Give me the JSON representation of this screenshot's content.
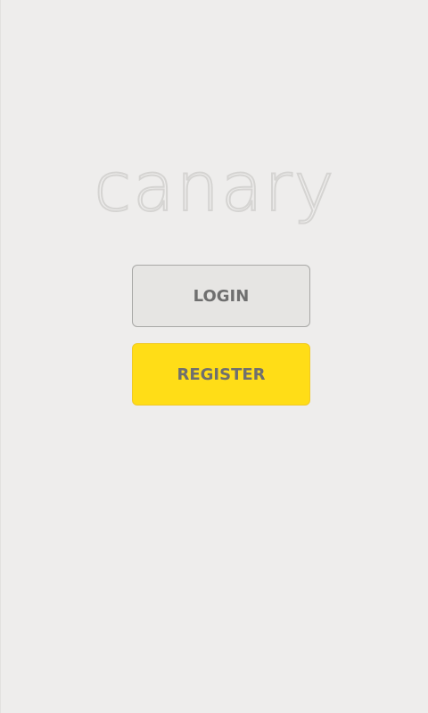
{
  "app": {
    "logo_text": "canary"
  },
  "actions": {
    "login_label": "LOGIN",
    "register_label": "REGISTER"
  },
  "colors": {
    "background": "#eeedec",
    "login_button": "#e6e5e3",
    "register_button": "#ffdd17",
    "button_text": "#6f6f6f",
    "logo_outline": "#d5d4d2"
  }
}
